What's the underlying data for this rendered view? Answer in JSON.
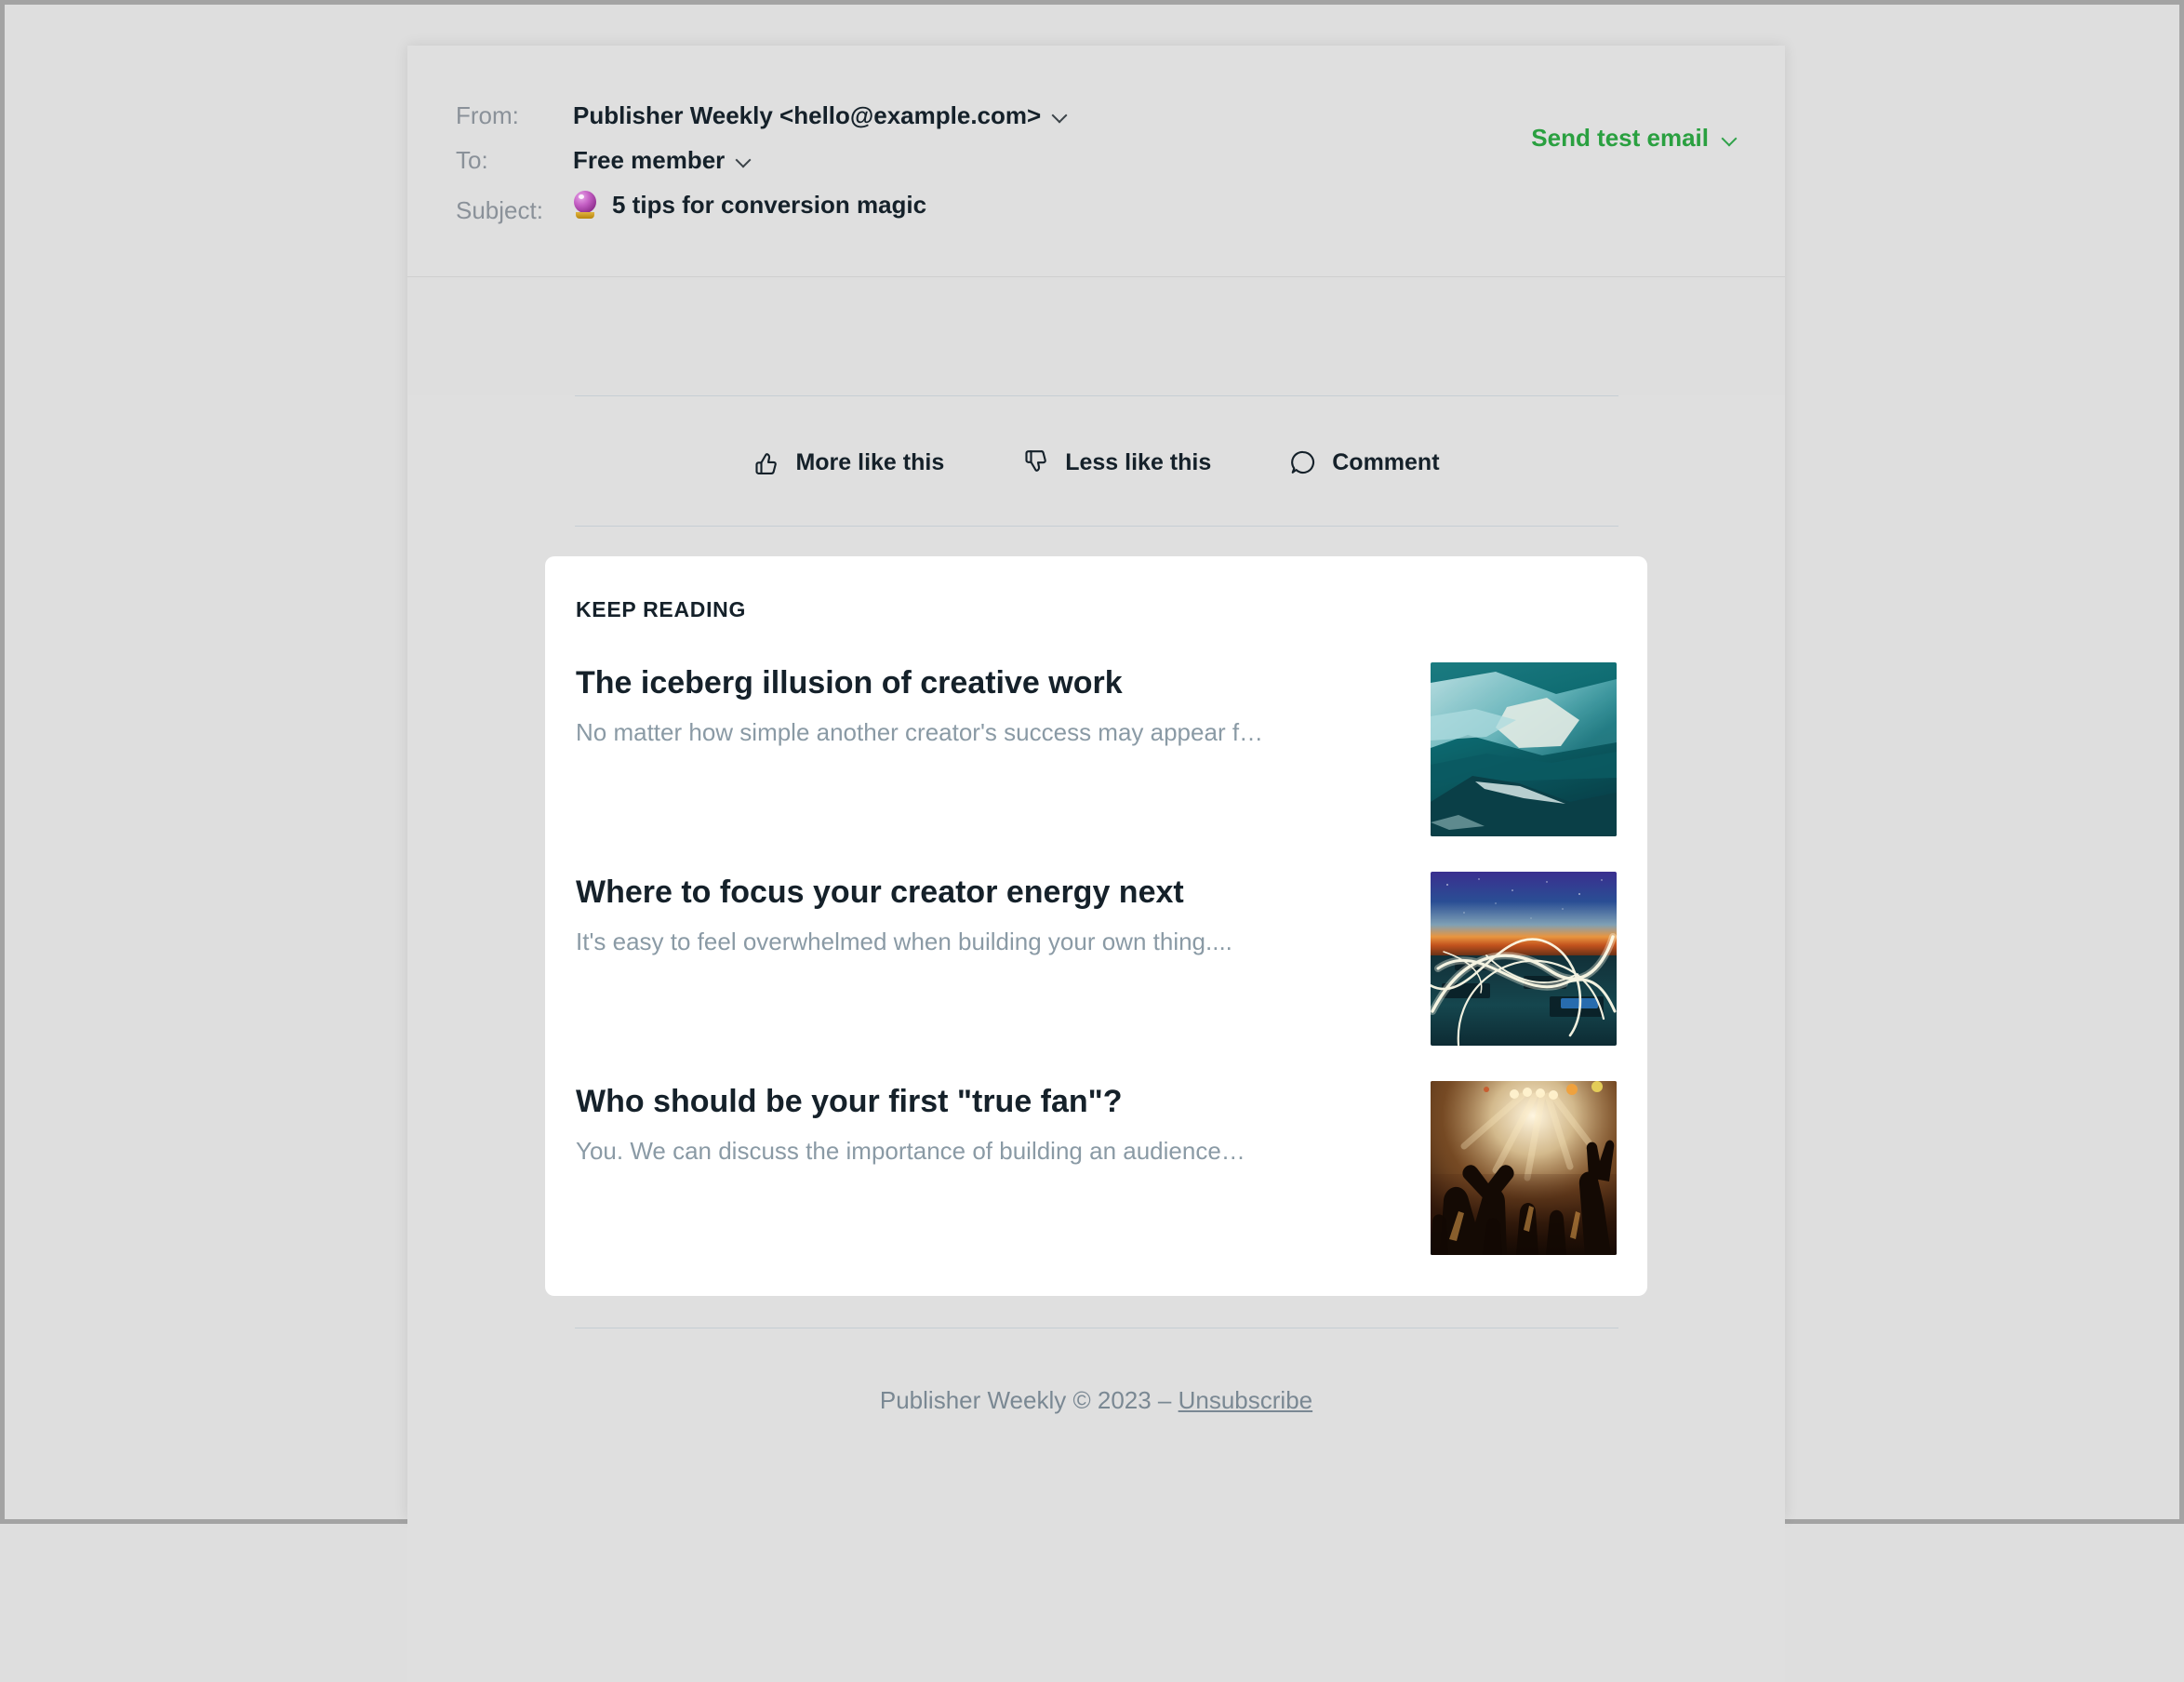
{
  "header": {
    "from_label": "From:",
    "from_value": "Publisher Weekly <hello@example.com>",
    "to_label": "To:",
    "to_value": "Free member",
    "subject_label": "Subject:",
    "subject_emoji": "crystal-ball",
    "subject_value": "5 tips for conversion magic",
    "send_test_label": "Send test email"
  },
  "feedback": {
    "more_like_this": "More like this",
    "less_like_this": "Less like this",
    "comment": "Comment"
  },
  "keep_reading": {
    "heading": "KEEP READING",
    "articles": [
      {
        "title": "The iceberg illusion of creative work",
        "excerpt": "No matter how simple another creator's success may appear f…",
        "image": "iceberg-underwater-teal"
      },
      {
        "title": "Where to focus your creator energy next",
        "excerpt": "It's easy to feel overwhelmed when building your own thing....",
        "image": "light-painting-rooftop-sunset"
      },
      {
        "title": "Who should be your first \"true fan\"?",
        "excerpt": "You. We can discuss the importance of building an audience…",
        "image": "concert-crowd-hands-stage-lights"
      }
    ]
  },
  "footer": {
    "copyright": "Publisher Weekly © 2023 – ",
    "unsubscribe": "Unsubscribe"
  },
  "colors": {
    "accent_green": "#2aa040",
    "text_dark": "#15212a",
    "text_muted": "#8a9aa5",
    "page_background": "#dedede",
    "card_background": "#ffffff",
    "divider": "#c6ced4"
  }
}
